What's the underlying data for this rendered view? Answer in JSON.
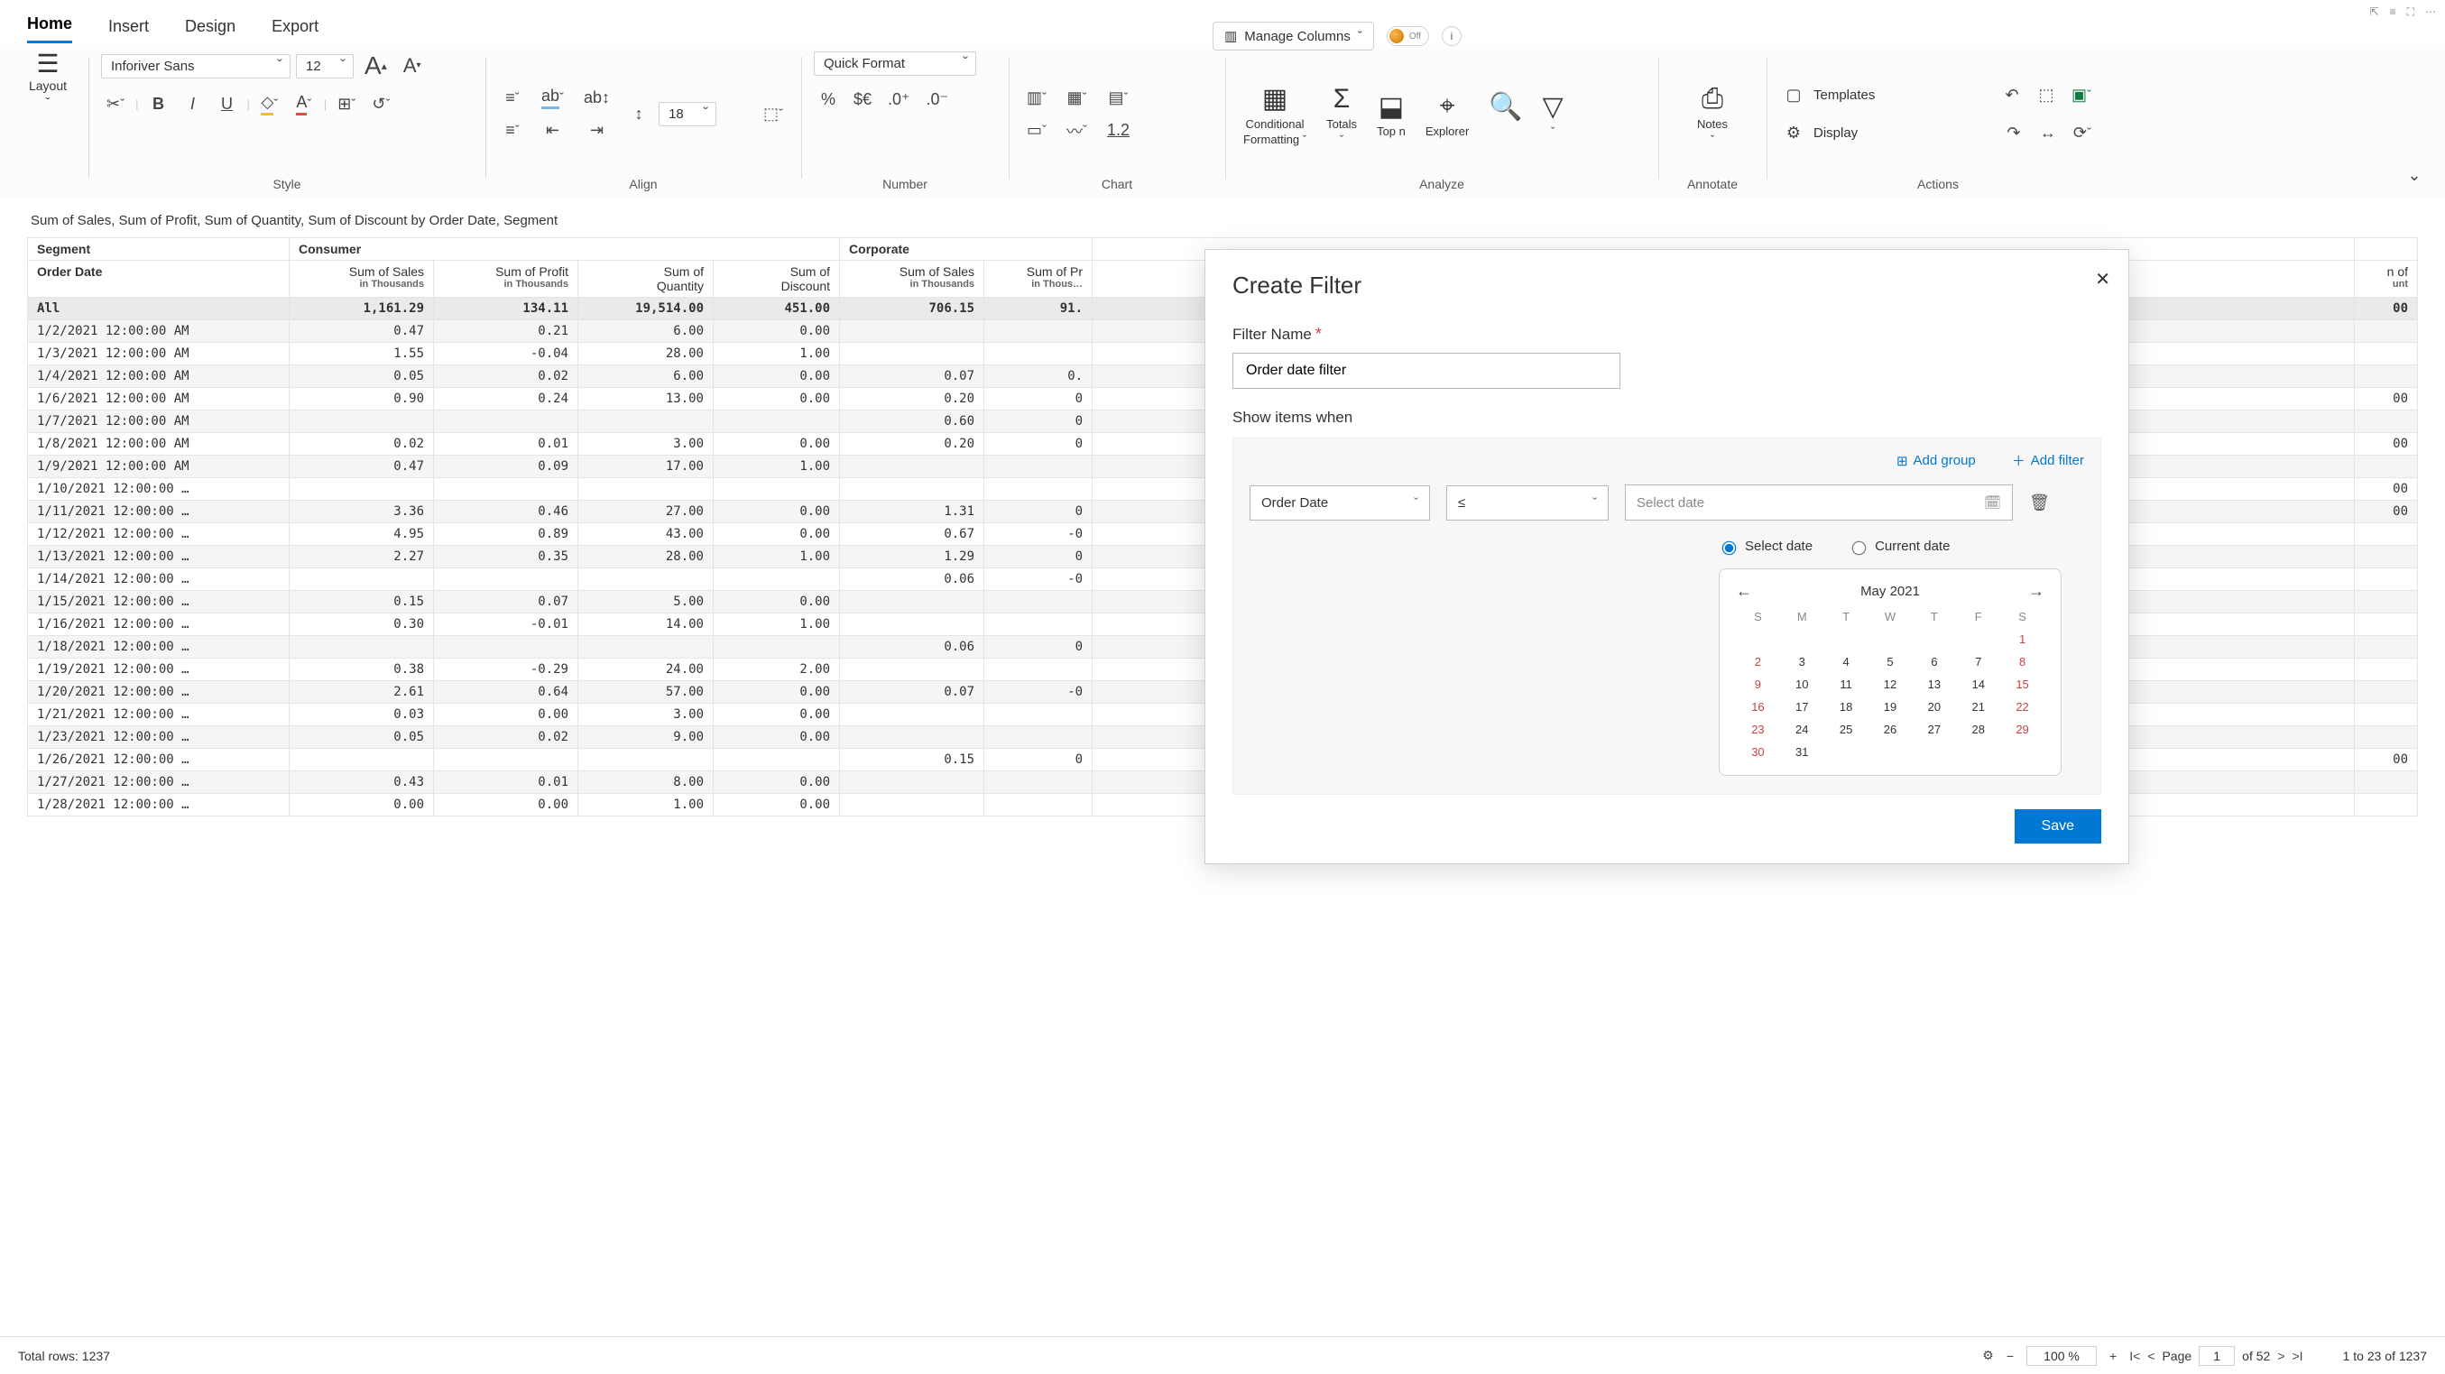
{
  "window_controls": [
    "⇱",
    "≡",
    "⛶",
    "⋯"
  ],
  "menu_tabs": [
    "Home",
    "Insert",
    "Design",
    "Export"
  ],
  "active_tab": "Home",
  "manage_columns": "Manage Columns",
  "toggle_label": "Off",
  "ribbon": {
    "layout": "Layout",
    "font_name": "Inforiver Sans",
    "font_size": "12",
    "quick_format": "Quick Format",
    "line_spacing": "18",
    "conditional": "Conditional",
    "formatting": "Formatting",
    "totals": "Totals",
    "topn": "Top n",
    "explorer": "Explorer",
    "notes": "Notes",
    "templates": "Templates",
    "display": "Display",
    "underline_num": "1.2",
    "groups": {
      "style": "Style",
      "align": "Align",
      "number": "Number",
      "chart": "Chart",
      "analyze": "Analyze",
      "annotate": "Annotate",
      "actions": "Actions"
    }
  },
  "report": {
    "title": "Sum of Sales, Sum of Profit, Sum of Quantity, Sum of Discount by Order Date, Segment",
    "segment_label": "Segment",
    "orderdate_label": "Order Date",
    "segments": [
      "Consumer",
      "Corporate"
    ],
    "partial_col_head": "n of",
    "partial_col_sub": "unt",
    "columns": [
      {
        "main": "Sum of Sales",
        "sub": "in Thousands"
      },
      {
        "main": "Sum of Profit",
        "sub": "in Thousands"
      },
      {
        "main": "Sum of",
        "sub": "Quantity",
        "nobr": true
      },
      {
        "main": "Sum of",
        "sub": "Discount",
        "nobr": true
      },
      {
        "main": "Sum of Sales",
        "sub": "in Thousands"
      },
      {
        "main": "Sum of Pr",
        "sub": "in Thous…"
      }
    ],
    "all_label": "All",
    "all_row": [
      "1,161.29",
      "134.11",
      "19,514.00",
      "451.00",
      "706.15",
      "91."
    ],
    "all_last": "00",
    "rows": [
      {
        "d": "1/2/2021 12:00:00 AM",
        "v": [
          "0.47",
          "0.21",
          "6.00",
          "0.00",
          "",
          ""
        ],
        "last": ""
      },
      {
        "d": "1/3/2021 12:00:00 AM",
        "v": [
          "1.55",
          "-0.04",
          "28.00",
          "1.00",
          "",
          ""
        ],
        "last": ""
      },
      {
        "d": "1/4/2021 12:00:00 AM",
        "v": [
          "0.05",
          "0.02",
          "6.00",
          "0.00",
          "0.07",
          "0."
        ],
        "last": ""
      },
      {
        "d": "1/6/2021 12:00:00 AM",
        "v": [
          "0.90",
          "0.24",
          "13.00",
          "0.00",
          "0.20",
          "0"
        ],
        "last": "00"
      },
      {
        "d": "1/7/2021 12:00:00 AM",
        "v": [
          "",
          "",
          "",
          "",
          "0.60",
          "0"
        ],
        "last": ""
      },
      {
        "d": "1/8/2021 12:00:00 AM",
        "v": [
          "0.02",
          "0.01",
          "3.00",
          "0.00",
          "0.20",
          "0"
        ],
        "last": "00"
      },
      {
        "d": "1/9/2021 12:00:00 AM",
        "v": [
          "0.47",
          "0.09",
          "17.00",
          "1.00",
          "",
          ""
        ],
        "last": ""
      },
      {
        "d": "1/10/2021 12:00:00 …",
        "v": [
          "",
          "",
          "",
          "",
          "",
          ""
        ],
        "last": "00"
      },
      {
        "d": "1/11/2021 12:00:00 …",
        "v": [
          "3.36",
          "0.46",
          "27.00",
          "0.00",
          "1.31",
          "0"
        ],
        "last": "00"
      },
      {
        "d": "1/12/2021 12:00:00 …",
        "v": [
          "4.95",
          "0.89",
          "43.00",
          "0.00",
          "0.67",
          "-0"
        ],
        "last": ""
      },
      {
        "d": "1/13/2021 12:00:00 …",
        "v": [
          "2.27",
          "0.35",
          "28.00",
          "1.00",
          "1.29",
          "0"
        ],
        "last": ""
      },
      {
        "d": "1/14/2021 12:00:00 …",
        "v": [
          "",
          "",
          "",
          "",
          "0.06",
          "-0"
        ],
        "last": ""
      },
      {
        "d": "1/15/2021 12:00:00 …",
        "v": [
          "0.15",
          "0.07",
          "5.00",
          "0.00",
          "",
          ""
        ],
        "last": ""
      },
      {
        "d": "1/16/2021 12:00:00 …",
        "v": [
          "0.30",
          "-0.01",
          "14.00",
          "1.00",
          "",
          ""
        ],
        "last": ""
      },
      {
        "d": "1/18/2021 12:00:00 …",
        "v": [
          "",
          "",
          "",
          "",
          "0.06",
          "0"
        ],
        "last": ""
      },
      {
        "d": "1/19/2021 12:00:00 …",
        "v": [
          "0.38",
          "-0.29",
          "24.00",
          "2.00",
          "",
          ""
        ],
        "last": ""
      },
      {
        "d": "1/20/2021 12:00:00 …",
        "v": [
          "2.61",
          "0.64",
          "57.00",
          "0.00",
          "0.07",
          "-0"
        ],
        "last": ""
      },
      {
        "d": "1/21/2021 12:00:00 …",
        "v": [
          "0.03",
          "0.00",
          "3.00",
          "0.00",
          "",
          ""
        ],
        "last": ""
      },
      {
        "d": "1/23/2021 12:00:00 …",
        "v": [
          "0.05",
          "0.02",
          "9.00",
          "0.00",
          "",
          ""
        ],
        "last": ""
      },
      {
        "d": "1/26/2021 12:00:00 …",
        "v": [
          "",
          "",
          "",
          "",
          "0.15",
          "0"
        ],
        "last": "00"
      },
      {
        "d": "1/27/2021 12:00:00 …",
        "v": [
          "0.43",
          "0.01",
          "8.00",
          "0.00",
          "",
          ""
        ],
        "last": ""
      },
      {
        "d": "1/28/2021 12:00:00 …",
        "v": [
          "0.00",
          "0.00",
          "1.00",
          "0.00",
          "",
          ""
        ],
        "last": ""
      }
    ]
  },
  "modal": {
    "title": "Create Filter",
    "name_label": "Filter Name",
    "name_value": "Order date filter",
    "show_label": "Show items when",
    "add_group": "Add group",
    "add_filter": "Add filter",
    "field": "Order Date",
    "op": "≤",
    "date_placeholder": "Select date",
    "radio_select": "Select date",
    "radio_current": "Current date",
    "cal_month": "May 2021",
    "dow": [
      "S",
      "M",
      "T",
      "W",
      "T",
      "F",
      "S"
    ],
    "weeks": [
      [
        "",
        "",
        "",
        "",
        "",
        "",
        "1"
      ],
      [
        "2",
        "3",
        "4",
        "5",
        "6",
        "7",
        "8"
      ],
      [
        "9",
        "10",
        "11",
        "12",
        "13",
        "14",
        "15"
      ],
      [
        "16",
        "17",
        "18",
        "19",
        "20",
        "21",
        "22"
      ],
      [
        "23",
        "24",
        "25",
        "26",
        "27",
        "28",
        "29"
      ],
      [
        "30",
        "31",
        "",
        "",
        "",
        "",
        ""
      ]
    ],
    "save": "Save"
  },
  "status": {
    "total_rows": "Total rows: 1237",
    "zoom": "100 %",
    "page_label": "Page",
    "page": "1",
    "of": "of 52",
    "range": "1 to 23 of 1237"
  }
}
